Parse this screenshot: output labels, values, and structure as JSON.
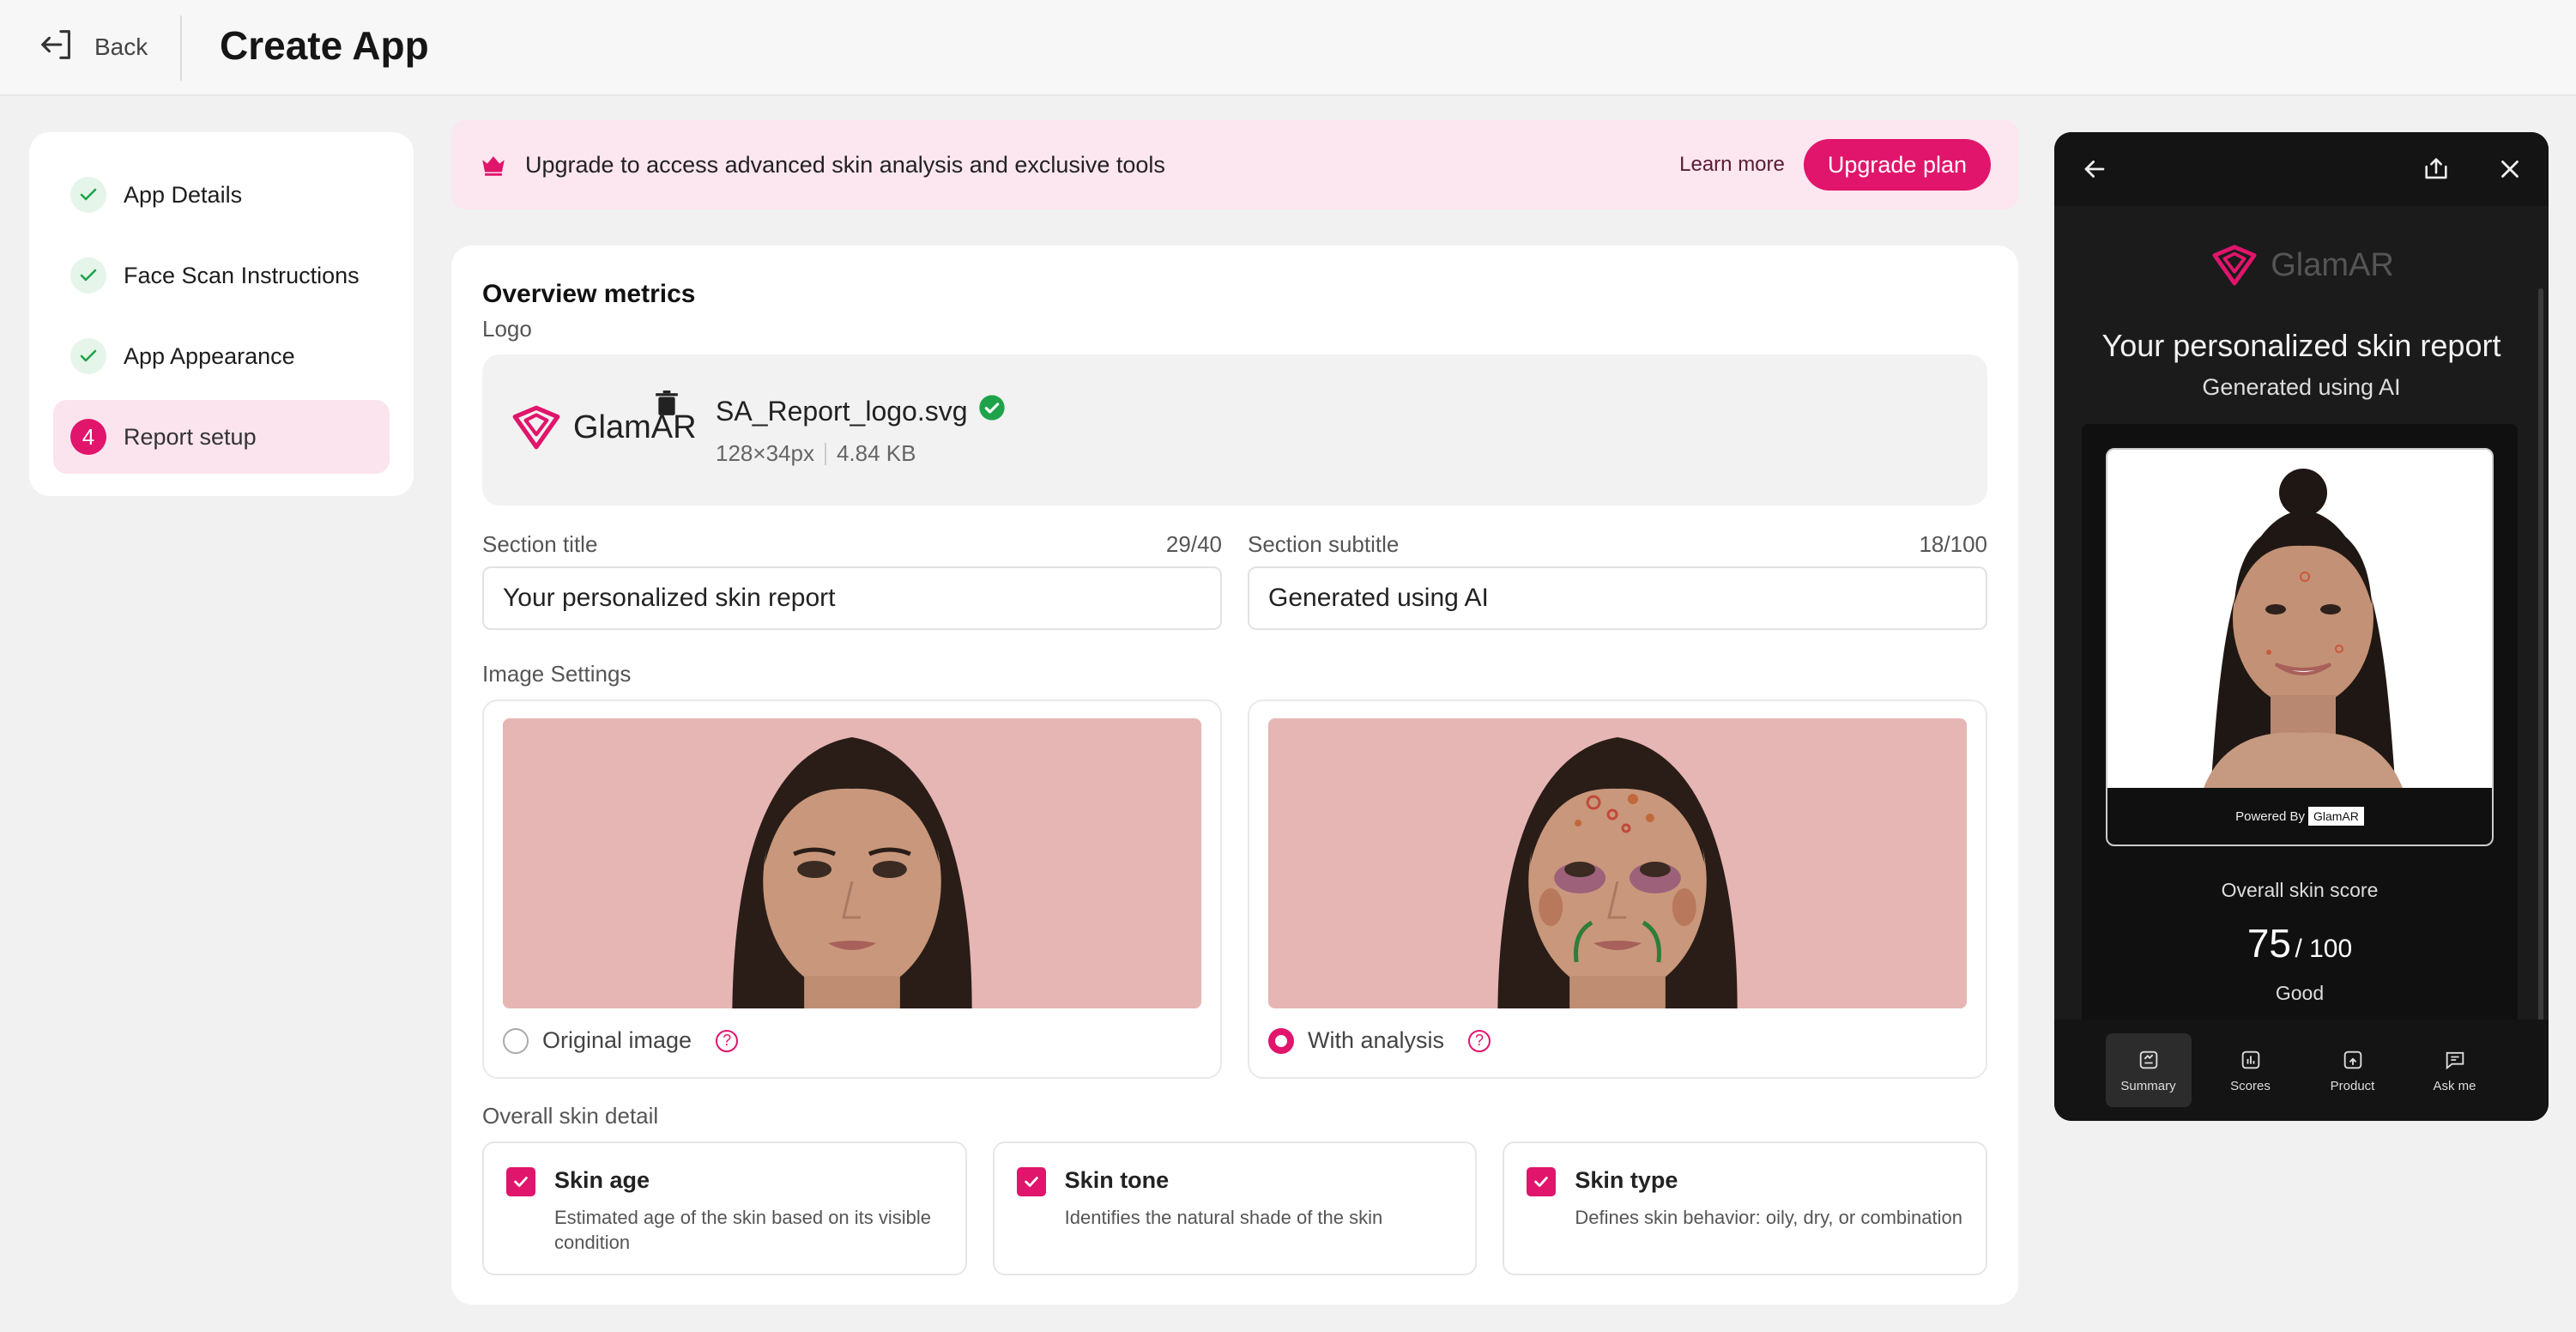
{
  "header": {
    "back_label": "Back",
    "title": "Create App"
  },
  "stepper": {
    "steps": [
      {
        "label": "App Details",
        "status": "done"
      },
      {
        "label": "Face Scan Instructions",
        "status": "done"
      },
      {
        "label": "App Appearance",
        "status": "done"
      },
      {
        "label": "Report setup",
        "status": "active",
        "number": "4"
      }
    ]
  },
  "banner": {
    "text": "Upgrade to access advanced skin analysis and exclusive tools",
    "learn_more": "Learn more",
    "upgrade_label": "Upgrade plan",
    "icon": "crown-icon"
  },
  "main": {
    "heading": "Overview metrics",
    "logo_label": "Logo",
    "logo": {
      "wordmark": "GlamAR",
      "file_name": "SA_Report_logo.svg",
      "dimensions": "128×34px",
      "size": "4.84 KB"
    },
    "section_title": {
      "label": "Section title",
      "count": "29/40",
      "value": "Your personalized skin report"
    },
    "section_subtitle": {
      "label": "Section subtitle",
      "count": "18/100",
      "value": "Generated using AI"
    },
    "image_settings": {
      "label": "Image Settings",
      "options": [
        {
          "label": "Original image",
          "selected": false
        },
        {
          "label": "With analysis",
          "selected": true
        }
      ],
      "help_glyph": "?"
    },
    "skin_detail": {
      "label": "Overall skin detail",
      "items": [
        {
          "title": "Skin age",
          "desc": "Estimated age of the skin based on its visible condition",
          "checked": true
        },
        {
          "title": "Skin tone",
          "desc": "Identifies the natural shade of the skin",
          "checked": true
        },
        {
          "title": "Skin type",
          "desc": "Defines skin behavior: oily, dry, or combination",
          "checked": true
        }
      ]
    }
  },
  "preview": {
    "brand": "GlamAR",
    "title": "Your personalized skin report",
    "subtitle": "Generated using AI",
    "powered_by": "Powered By",
    "powered_brand": "GlamAR",
    "score_label": "Overall skin score",
    "score": "75",
    "score_max": "/ 100",
    "rating": "Good",
    "nav": [
      {
        "label": "Summary",
        "icon": "summary-icon"
      },
      {
        "label": "Scores",
        "icon": "scores-icon"
      },
      {
        "label": "Product",
        "icon": "product-icon"
      },
      {
        "label": "Ask me",
        "icon": "chat-icon"
      }
    ]
  },
  "colors": {
    "accent": "#e0156b",
    "banner_bg": "#fce6ef",
    "success": "#1fa34a",
    "phone_bg": "#1b1b1b"
  }
}
